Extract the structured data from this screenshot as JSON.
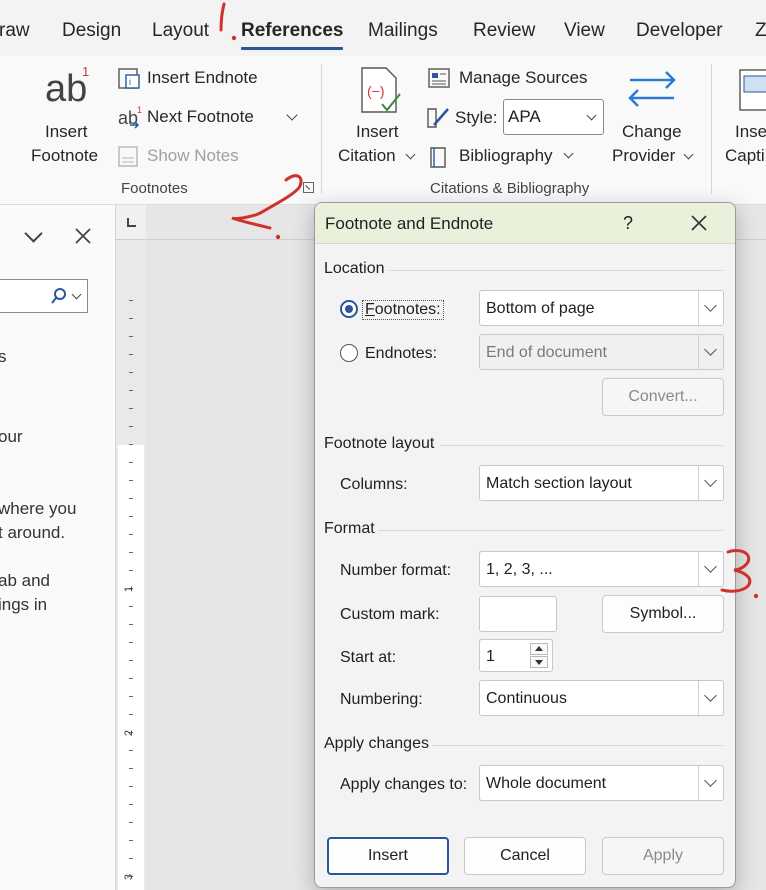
{
  "tabs": [
    {
      "label": "raw"
    },
    {
      "label": "Design"
    },
    {
      "label": "Layout"
    },
    {
      "label": "References"
    },
    {
      "label": "Mailings"
    },
    {
      "label": "Review"
    },
    {
      "label": "View"
    },
    {
      "label": "Developer"
    },
    {
      "label": "Z"
    }
  ],
  "ribbon": {
    "insert_footnote": {
      "line1": "Insert",
      "line2": "Footnote",
      "icon_text": "ab",
      "superscript": "1"
    },
    "insert_endnote": "Insert Endnote",
    "next_footnote": "Next Footnote",
    "show_notes": "Show Notes",
    "footnotes_group": "Footnotes",
    "insert_citation": {
      "line1": "Insert",
      "line2": "Citation"
    },
    "manage_sources": "Manage Sources",
    "style_label": "Style:",
    "style_value": "APA",
    "bibliography": "Bibliography",
    "change_provider": {
      "line1": "Change",
      "line2": "Provider"
    },
    "citations_group": "Citations & Bibliography",
    "insert_caption": {
      "line1": "Inse",
      "line2": "Capti"
    }
  },
  "left_pane": {
    "lines": [
      "s",
      "our",
      "where you",
      "t around.",
      "ab and",
      "ings in"
    ]
  },
  "ruler": {
    "marks": [
      "1",
      "2",
      "3"
    ]
  },
  "dialog": {
    "title": "Footnote and Endnote",
    "help": "?",
    "close": "✕",
    "location": {
      "section": "Location",
      "footnotes_label": "Footnotes:",
      "footnotes_value": "Bottom of page",
      "footnotes_selected": true,
      "endnotes_label": "Endnotes:",
      "endnotes_value": "End of document",
      "convert": "Convert..."
    },
    "layout": {
      "section": "Footnote layout",
      "columns_label": "Columns:",
      "columns_value": "Match section layout"
    },
    "format": {
      "section": "Format",
      "number_format_label": "Number format:",
      "number_format_value": "1, 2, 3, ...",
      "custom_mark_label": "Custom mark:",
      "custom_mark_value": "",
      "symbol": "Symbol...",
      "start_at_label": "Start at:",
      "start_at_value": "1",
      "numbering_label": "Numbering:",
      "numbering_value": "Continuous"
    },
    "apply": {
      "section": "Apply changes",
      "apply_to_label": "Apply changes to:",
      "apply_to_value": "Whole document"
    },
    "buttons": {
      "insert": "Insert",
      "cancel": "Cancel",
      "apply": "Apply"
    }
  },
  "colors": {
    "accent": "#2b579a",
    "title_bar": "#e9f1da",
    "annotation": "#d0312d"
  }
}
